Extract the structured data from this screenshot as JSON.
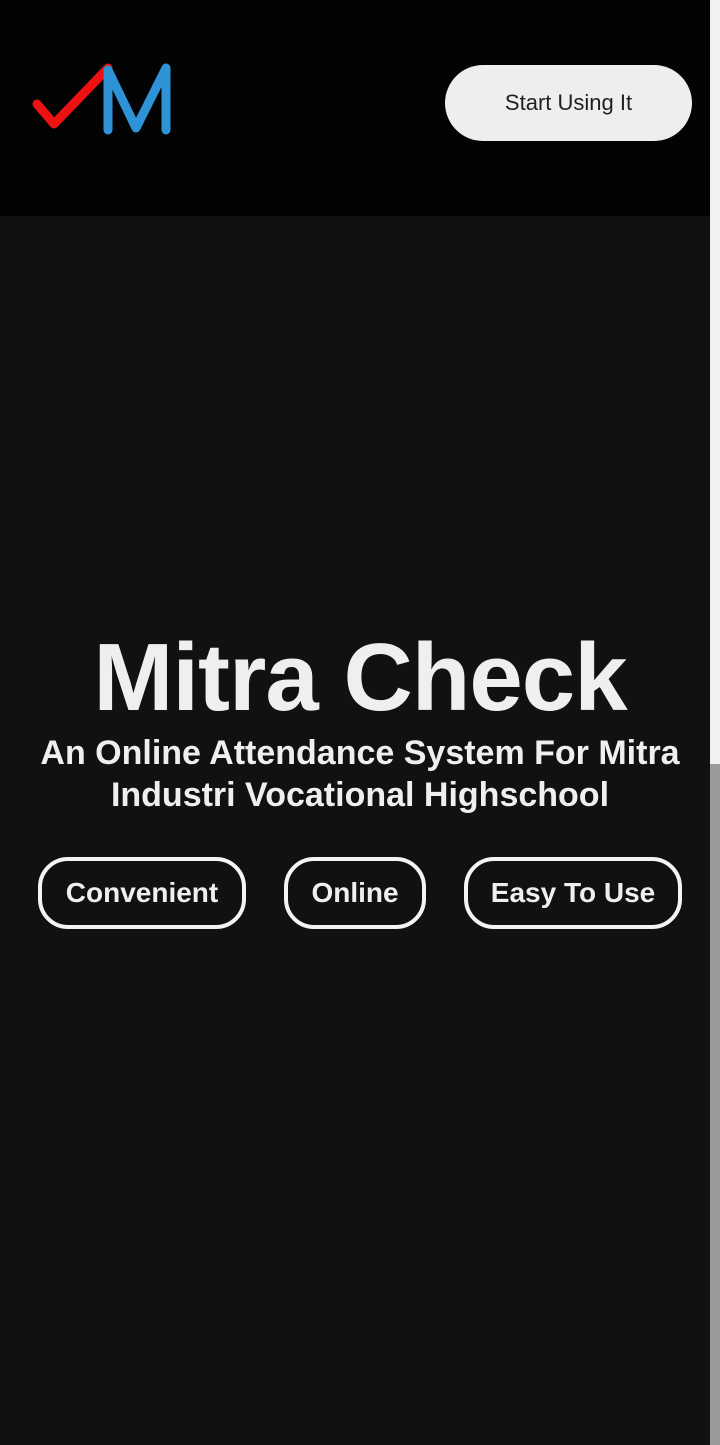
{
  "header": {
    "logo_icon": "mitra-check-logo-icon",
    "cta_label": "Start Using It"
  },
  "hero": {
    "title": "Mitra Check",
    "subtitle_line1": "An Online Attendance System For Mitra",
    "subtitle_line2": "Industri Vocational Highschool",
    "features": [
      "Convenient",
      "Online",
      "Easy To Use"
    ]
  },
  "colors": {
    "background": "#111111",
    "header_background": "#030303",
    "logo_check": "#ee1111",
    "logo_m": "#2e93d6",
    "text": "#efefef",
    "button_background": "#eeeeee"
  }
}
